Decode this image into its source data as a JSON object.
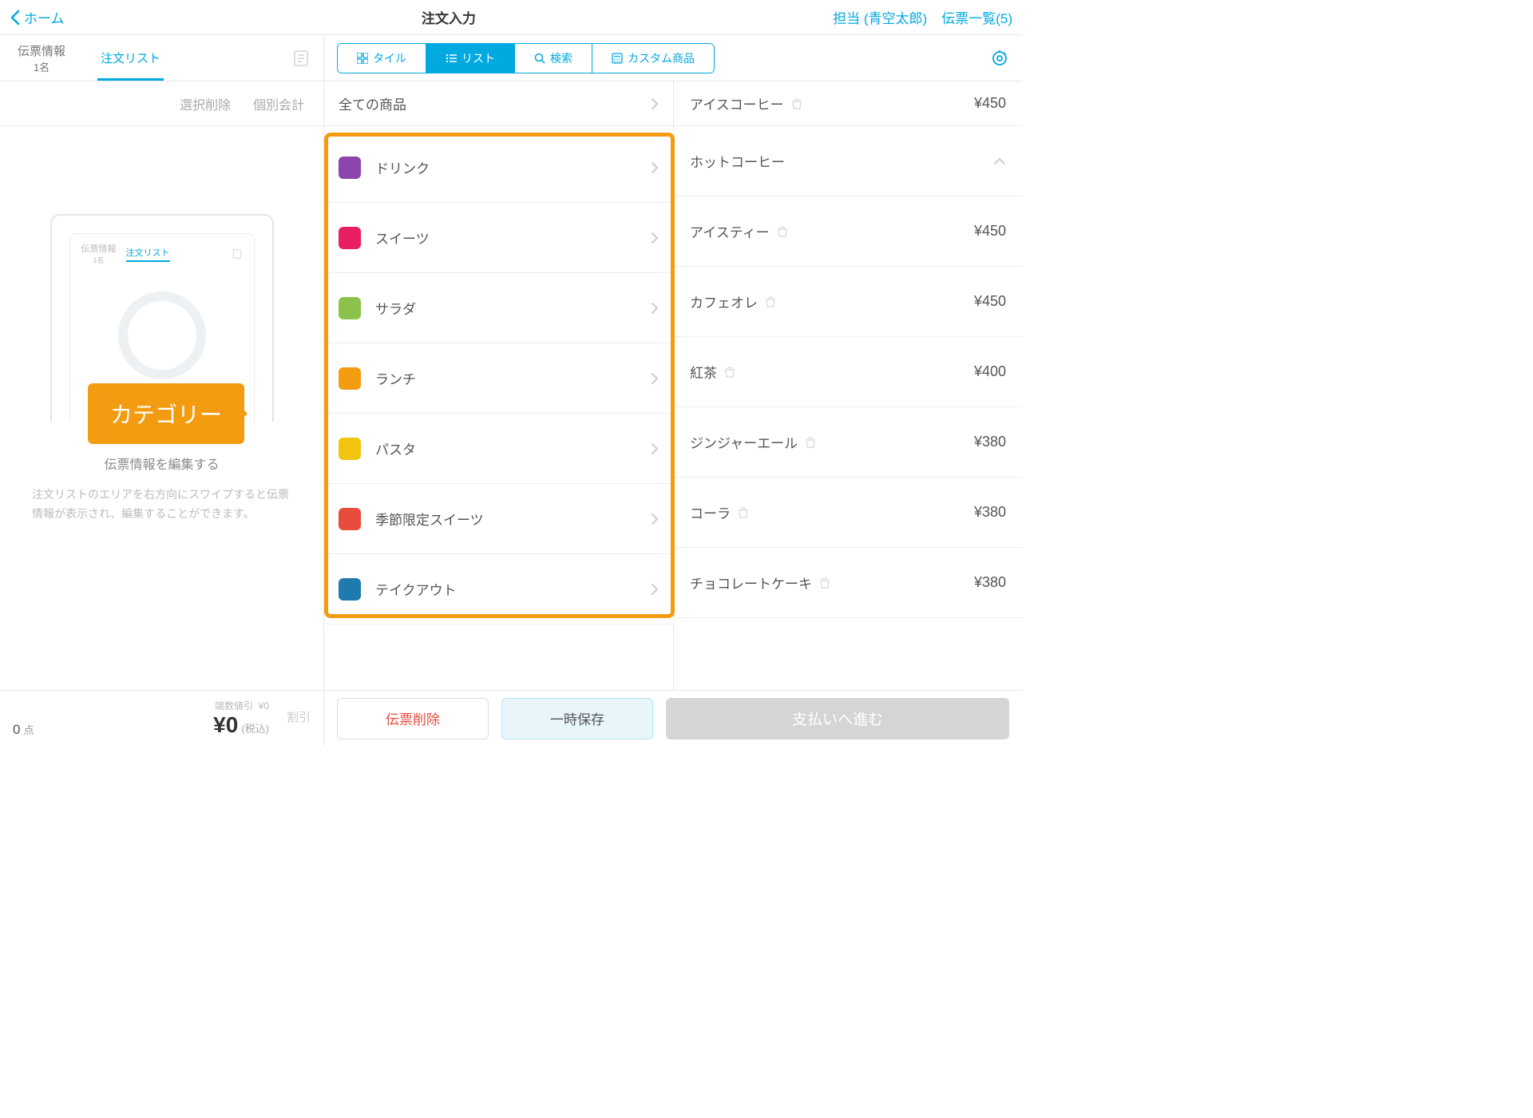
{
  "header": {
    "back": "ホーム",
    "title": "注文入力",
    "staff": "担当 (青空太郎)",
    "slips": "伝票一覧(5)"
  },
  "tabs": {
    "slip_info": "伝票情報",
    "slip_sub": "1名",
    "order_list": "注文リスト"
  },
  "view_segments": {
    "tile": "タイル",
    "list": "リスト",
    "search": "検索",
    "custom": "カスタム商品"
  },
  "left_actions": {
    "delete_sel": "選択削除",
    "indiv_pay": "個別会計"
  },
  "preview": {
    "tab1_line1": "伝票情報",
    "tab1_line2": "1名",
    "tab2": "注文リスト",
    "title": "伝票情報を編集する",
    "desc": "注文リストのエリアを右方向にスワイプすると伝票情報が表示され、編集することができます。"
  },
  "callout": "カテゴリー",
  "all_products": "全ての商品",
  "categories": [
    {
      "name": "ドリンク",
      "color": "#8E44AD"
    },
    {
      "name": "スイーツ",
      "color": "#E91E63"
    },
    {
      "name": "サラダ",
      "color": "#8BC34A"
    },
    {
      "name": "ランチ",
      "color": "#F39C12"
    },
    {
      "name": "パスタ",
      "color": "#F1C40F"
    },
    {
      "name": "季節限定スイーツ",
      "color": "#E74C3C"
    },
    {
      "name": "テイクアウト",
      "color": "#1F7AB0"
    }
  ],
  "products": [
    {
      "name": "アイスコーヒー",
      "price": "¥450",
      "bag": true
    },
    {
      "name": "ホットコーヒー",
      "price": "",
      "bag": false,
      "expand": true
    },
    {
      "name": "アイスティー",
      "price": "¥450",
      "bag": true
    },
    {
      "name": "カフェオレ",
      "price": "¥450",
      "bag": true
    },
    {
      "name": "紅茶",
      "price": "¥400",
      "bag": true
    },
    {
      "name": "ジンジャーエール",
      "price": "¥380",
      "bag": true
    },
    {
      "name": "コーラ",
      "price": "¥380",
      "bag": true
    },
    {
      "name": "チョコレートケーキ",
      "price": "¥380",
      "bag": true
    }
  ],
  "bottom": {
    "count": "0",
    "count_unit": "点",
    "rounding": "端数値引",
    "rounding_val": "¥0",
    "total": "¥0",
    "tax": "(税込)",
    "discount": "割引",
    "delete_slip": "伝票削除",
    "save": "一時保存",
    "pay": "支払いへ進む"
  }
}
